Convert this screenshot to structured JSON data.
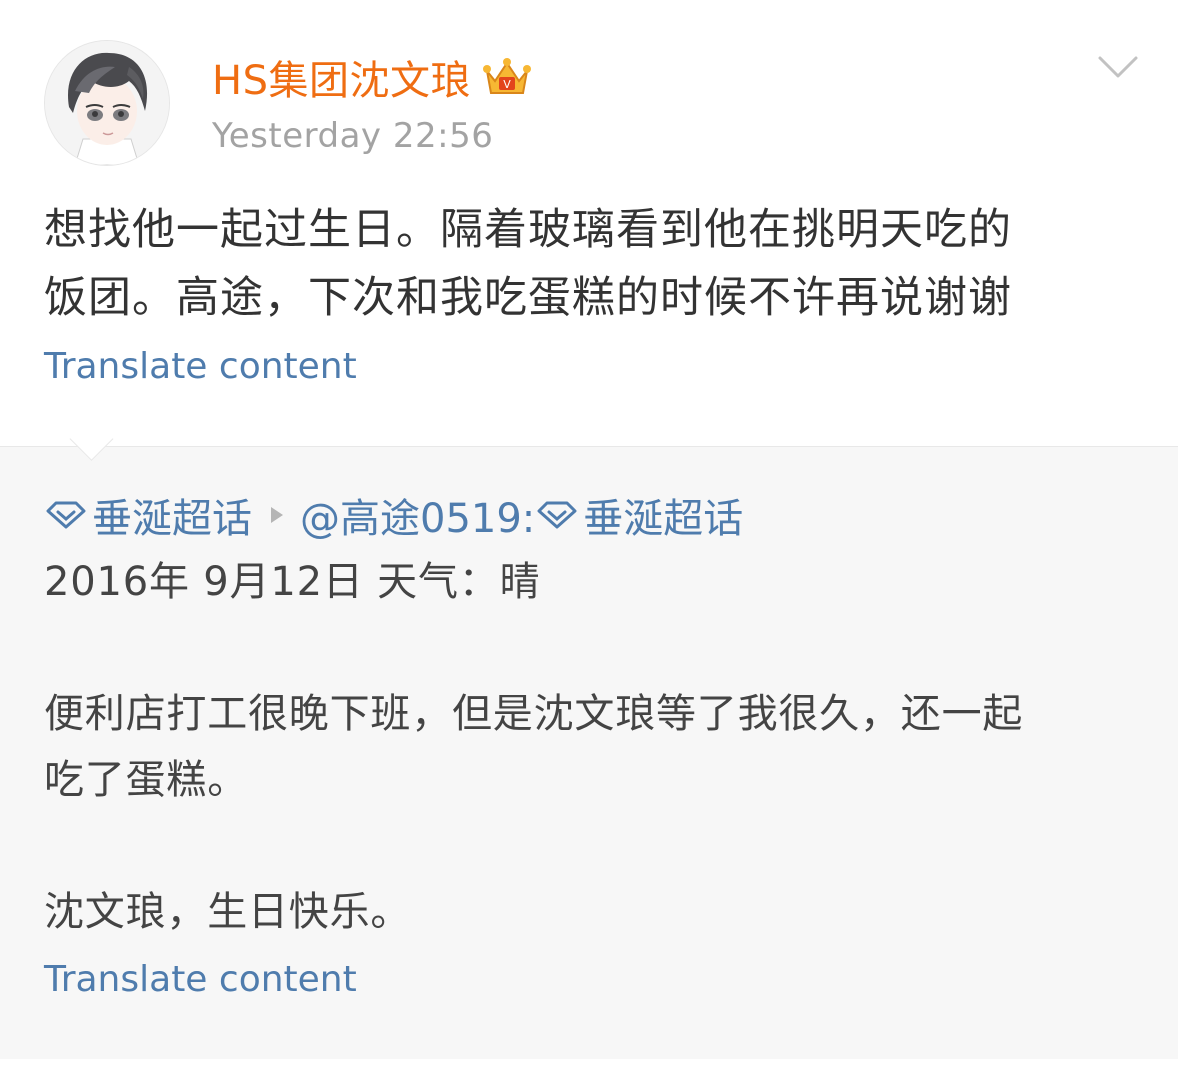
{
  "post": {
    "username": "HS集团沈文琅",
    "timestamp": "Yesterday 22:56",
    "body_lines": [
      "想找他一起过生日。隔着玻璃看到他在挑明天吃的",
      "饭团。高途，下次和我吃蛋糕的时候不许再说谢谢"
    ],
    "translate_label": "Translate content",
    "badge_icon": "crown-badge-icon",
    "menu_icon": "chevron-down-icon"
  },
  "repost": {
    "topic_1": "垂涎超话",
    "mention": "@高途0519:",
    "topic_2": "垂涎超话",
    "lines": [
      "2016年 9月12日 天气：晴",
      "",
      "便利店打工很晚下班，但是沈文琅等了我很久，还一起",
      "吃了蛋糕。",
      "",
      "沈文琅，生日快乐。"
    ],
    "translate_label": "Translate content"
  },
  "colors": {
    "username": "#ef6d12",
    "link": "#4f7cad",
    "timestamp": "#a3a3a3",
    "body": "#333333",
    "repost_bg": "#f7f7f7"
  }
}
